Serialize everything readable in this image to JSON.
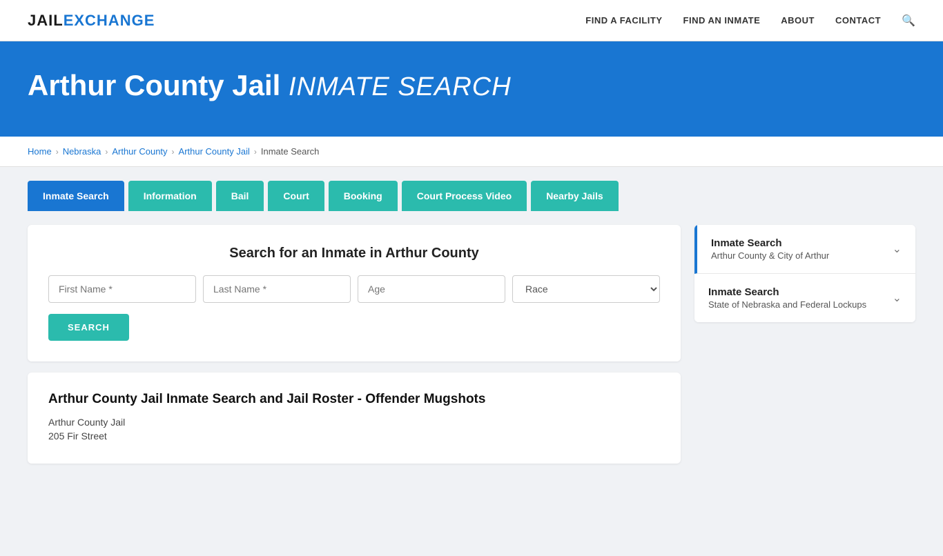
{
  "logo": {
    "part1": "JAIL",
    "part2": "EXCHANGE"
  },
  "nav": {
    "links": [
      {
        "id": "find-facility",
        "label": "FIND A FACILITY"
      },
      {
        "id": "find-inmate",
        "label": "FIND AN INMATE"
      },
      {
        "id": "about",
        "label": "ABOUT"
      },
      {
        "id": "contact",
        "label": "CONTACT"
      }
    ]
  },
  "hero": {
    "title_bold": "Arthur County Jail",
    "title_italic": "INMATE SEARCH"
  },
  "breadcrumb": {
    "items": [
      {
        "label": "Home",
        "href": "#"
      },
      {
        "label": "Nebraska",
        "href": "#"
      },
      {
        "label": "Arthur County",
        "href": "#"
      },
      {
        "label": "Arthur County Jail",
        "href": "#"
      },
      {
        "label": "Inmate Search",
        "current": true
      }
    ]
  },
  "tabs": [
    {
      "id": "inmate-search",
      "label": "Inmate Search",
      "active": true
    },
    {
      "id": "information",
      "label": "Information",
      "active": false
    },
    {
      "id": "bail",
      "label": "Bail",
      "active": false
    },
    {
      "id": "court",
      "label": "Court",
      "active": false
    },
    {
      "id": "booking",
      "label": "Booking",
      "active": false
    },
    {
      "id": "court-process-video",
      "label": "Court Process Video",
      "active": false
    },
    {
      "id": "nearby-jails",
      "label": "Nearby Jails",
      "active": false
    }
  ],
  "search_section": {
    "heading": "Search for an Inmate in Arthur County",
    "fields": {
      "first_name_placeholder": "First Name *",
      "last_name_placeholder": "Last Name *",
      "age_placeholder": "Age",
      "race_placeholder": "Race"
    },
    "button_label": "SEARCH"
  },
  "info_section": {
    "heading": "Arthur County Jail Inmate Search and Jail Roster - Offender Mugshots",
    "line1": "Arthur County Jail",
    "line2": "205 Fir Street"
  },
  "sidebar": {
    "items": [
      {
        "id": "inmate-search-arthur",
        "title": "Inmate Search",
        "subtitle": "Arthur County & City of Arthur",
        "accent": true
      },
      {
        "id": "inmate-search-nebraska",
        "title": "Inmate Search",
        "subtitle": "State of Nebraska and Federal Lockups",
        "accent": false
      }
    ]
  }
}
